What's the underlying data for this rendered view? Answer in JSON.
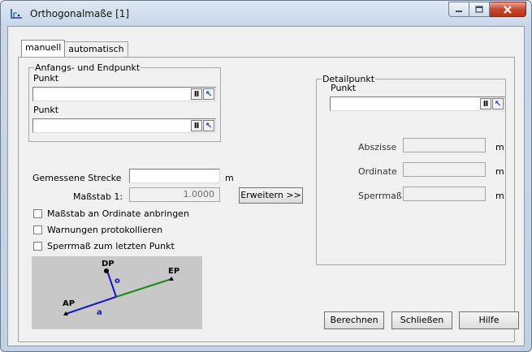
{
  "window": {
    "title": "Orthogonalmaße [1]"
  },
  "tabs": [
    {
      "label": "manuell"
    },
    {
      "label": "automatisch"
    }
  ],
  "start_end_group": {
    "title": "Anfangs- und Endpunkt",
    "point1_label": "Punkt",
    "point1_value": "",
    "point2_label": "Punkt",
    "point2_value": ""
  },
  "measured": {
    "label": "Gemessene Strecke",
    "value": "",
    "unit": "m"
  },
  "scale": {
    "label": "Maßstab 1:",
    "value": "1.0000"
  },
  "expand_button": "Erweitern >>",
  "options": [
    {
      "label": "Maßstab an Ordinate anbringen",
      "checked": false
    },
    {
      "label": "Warnungen protokollieren",
      "checked": false
    },
    {
      "label": "Sperrmaß zum letzten Punkt",
      "checked": false
    }
  ],
  "diagram": {
    "labels": {
      "dp": "DP",
      "ep": "EP",
      "ap": "AP",
      "a": "a",
      "o": "o"
    }
  },
  "detail_group": {
    "title": "Detailpunkt",
    "point_label": "Punkt",
    "point_value": "",
    "fields": [
      {
        "label": "Abszisse",
        "value": "",
        "unit": "m"
      },
      {
        "label": "Ordinate",
        "value": "",
        "unit": "m"
      },
      {
        "label": "Sperrmaß",
        "value": "",
        "unit": "m"
      }
    ]
  },
  "buttons": {
    "calculate": "Berechnen",
    "close": "Schließen",
    "help": "Hilfe"
  },
  "colors": {
    "diagram_bg": "#c8c8c8",
    "ordinate": "#1515c8",
    "baseline_green": "#1a8a1a",
    "close_red": "#c7472b"
  }
}
